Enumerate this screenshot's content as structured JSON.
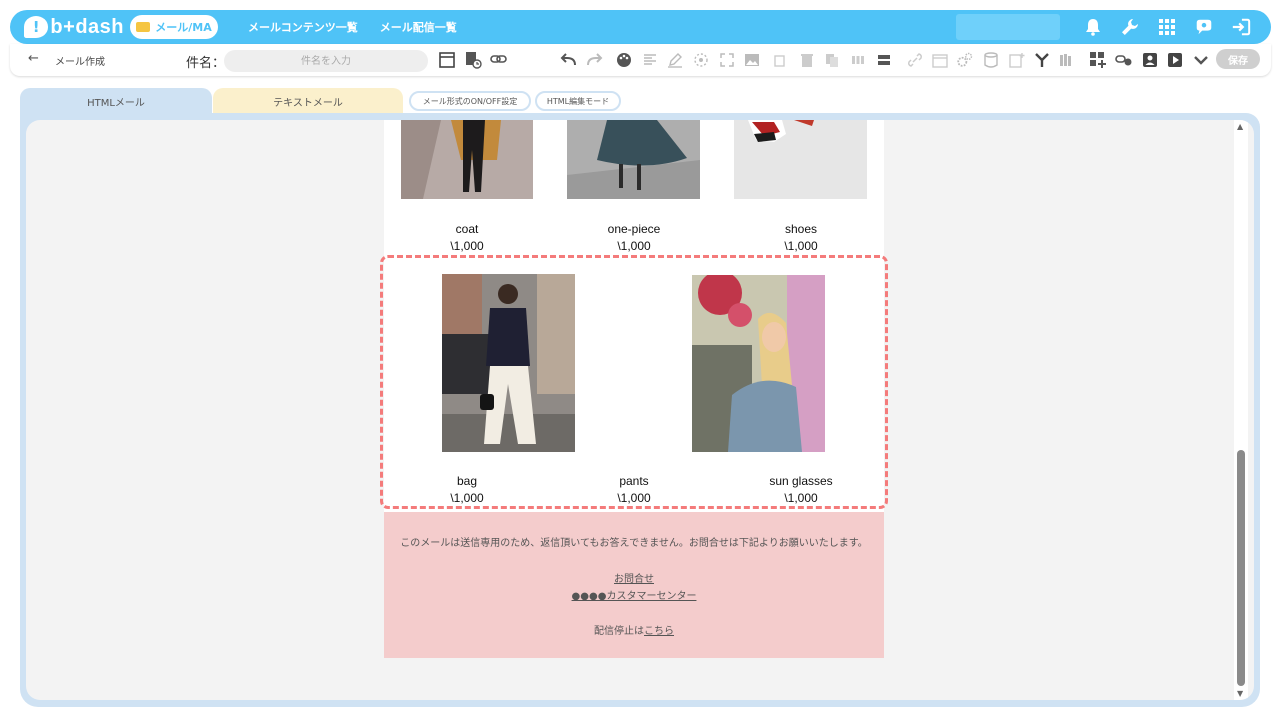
{
  "app": {
    "logo_text": "b+dash",
    "mode": "メール/MA",
    "nav": [
      "メールコンテンツ一覧",
      "メール配信一覧"
    ]
  },
  "toolbar": {
    "page_title": "メール作成",
    "subject_label": "件名：",
    "subject_placeholder": "件名を入力",
    "save_label": "保存"
  },
  "tabs": {
    "html": "HTMLメール",
    "text": "テキストメール",
    "onoff": "メール形式のON/OFF設定",
    "html_edit": "HTML編集モード"
  },
  "products": [
    {
      "name": "coat",
      "price": "\\1,000"
    },
    {
      "name": "one-piece",
      "price": "\\1,000"
    },
    {
      "name": "shoes",
      "price": "\\1,000"
    },
    {
      "name": "bag",
      "price": "\\1,000"
    },
    {
      "name": "pants",
      "price": "\\1,000"
    },
    {
      "name": "sun glasses",
      "price": "\\1,000"
    }
  ],
  "footer": {
    "notice": "このメールは送信専用のため、返信頂いてもお答えできません。お問合せは下記よりお願いいたします。",
    "contact": "お問合せ",
    "center": "●●●●カスタマーセンター",
    "unsub_prefix": "配信停止は",
    "unsub_link": "こちら"
  },
  "colors": {
    "brand": "#4fc3f7",
    "html_tab": "#cfe2f3",
    "text_tab": "#fbf0cc",
    "footer_bg": "#f4cccc",
    "selection": "#f47b7b"
  }
}
